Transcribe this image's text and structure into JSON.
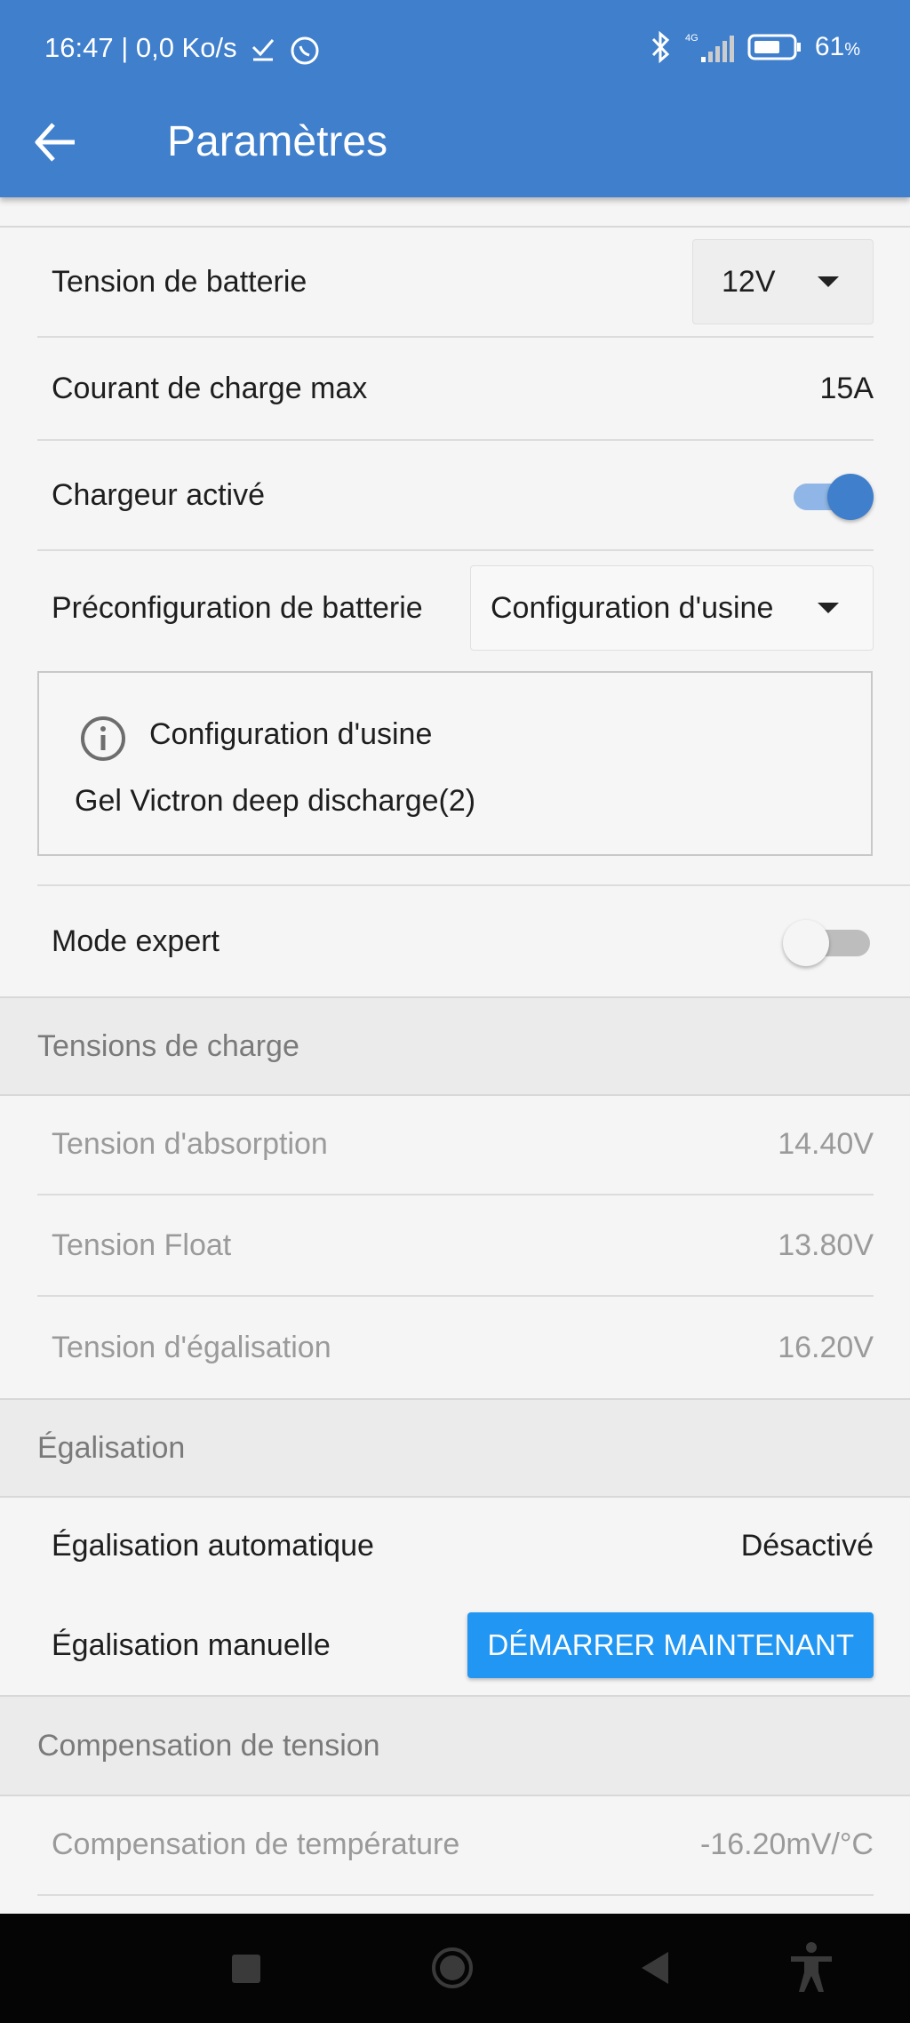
{
  "status_bar": {
    "time_speed": "16:47 | 0,0 Ko/s",
    "network": "4G",
    "battery_percent": "61",
    "battery_unit": "%"
  },
  "app_bar": {
    "title": "Paramètres"
  },
  "settings": {
    "battery_voltage": {
      "label": "Tension de batterie",
      "value": "12V"
    },
    "max_charge_current": {
      "label": "Courant de charge max",
      "value": "15A"
    },
    "charger_enabled": {
      "label": "Chargeur activé",
      "on": true
    },
    "battery_preset": {
      "label": "Préconfiguration de batterie",
      "value": "Configuration d'usine"
    },
    "preset_info": {
      "title": "Configuration d'usine",
      "description": "Gel Victron deep discharge(2)"
    },
    "expert_mode": {
      "label": "Mode expert",
      "on": false
    }
  },
  "sections": {
    "charge_voltages": {
      "title": "Tensions de charge",
      "absorption": {
        "label": "Tension d'absorption",
        "value": "14.40V"
      },
      "float": {
        "label": "Tension Float",
        "value": "13.80V"
      },
      "equalization": {
        "label": "Tension d'égalisation",
        "value": "16.20V"
      }
    },
    "equalization": {
      "title": "Égalisation",
      "automatic": {
        "label": "Égalisation automatique",
        "value": "Désactivé"
      },
      "manual": {
        "label": "Égalisation manuelle",
        "button": "DÉMARRER MAINTENANT"
      }
    },
    "voltage_compensation": {
      "title": "Compensation de tension",
      "temperature": {
        "label": "Compensation de température",
        "value": "-16.20mV/°C"
      }
    }
  },
  "colors": {
    "app_bar": "#3f7fcc",
    "toggle_on_thumb": "#3f7fcc",
    "toggle_on_track": "#8fb6e6",
    "toggle_off_thumb": "#f5f5f5",
    "toggle_off_track": "#bdbdbd",
    "button": "#2196f3"
  },
  "icons": {
    "status": [
      "download-check-icon",
      "whatsapp-icon",
      "bluetooth-icon",
      "signal-icon",
      "battery-icon"
    ],
    "app_bar": "arrow-back-icon",
    "info": "info-icon",
    "nav": [
      "recents-square-icon",
      "home-circle-icon",
      "back-triangle-icon",
      "accessibility-icon"
    ]
  }
}
